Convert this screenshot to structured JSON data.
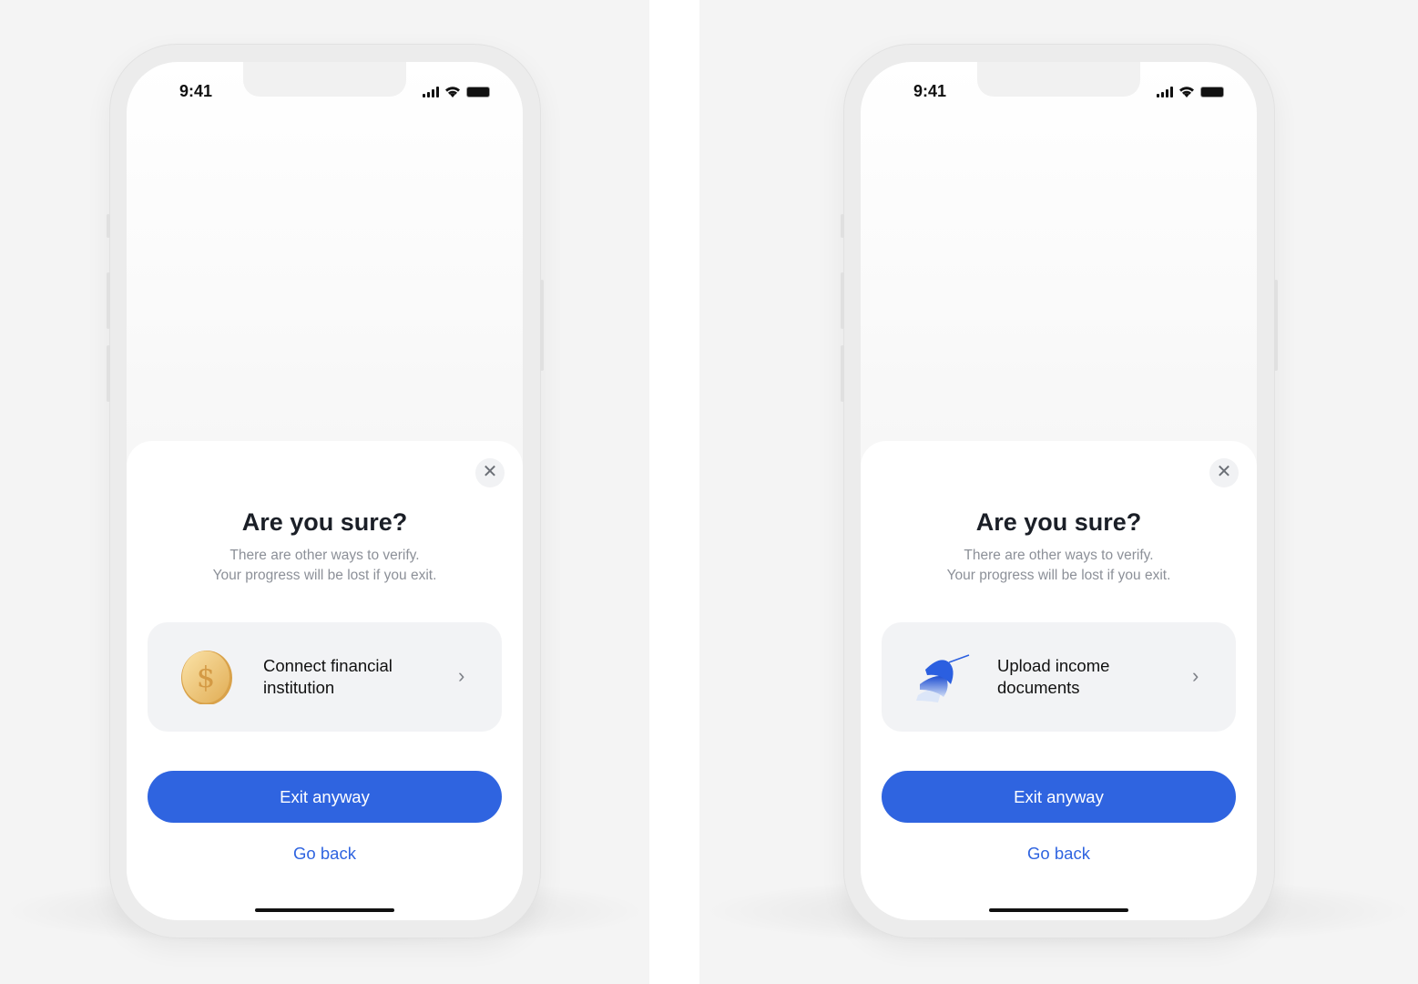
{
  "colors": {
    "accent": "#2f64e0",
    "card": "#f2f3f5",
    "background": "#f4f4f4"
  },
  "screens": [
    {
      "status": {
        "time": "9:41"
      },
      "dialog": {
        "close_icon": "close-icon",
        "title": "Are you sure?",
        "subtitle_line1": "There are other ways to verify.",
        "subtitle_line2": "Your progress will be lost if you exit.",
        "option": {
          "icon": "gold-coin-dollar-icon",
          "label": "Connect financial institution"
        },
        "exit_label": "Exit anyway",
        "back_label": "Go back"
      }
    },
    {
      "status": {
        "time": "9:41"
      },
      "dialog": {
        "close_icon": "close-icon",
        "title": "Are you sure?",
        "subtitle_line1": "There are other ways to verify.",
        "subtitle_line2": "Your progress will be lost if you exit.",
        "option": {
          "icon": "blue-documents-icon",
          "label": "Upload income documents"
        },
        "exit_label": "Exit anyway",
        "back_label": "Go back"
      }
    }
  ]
}
